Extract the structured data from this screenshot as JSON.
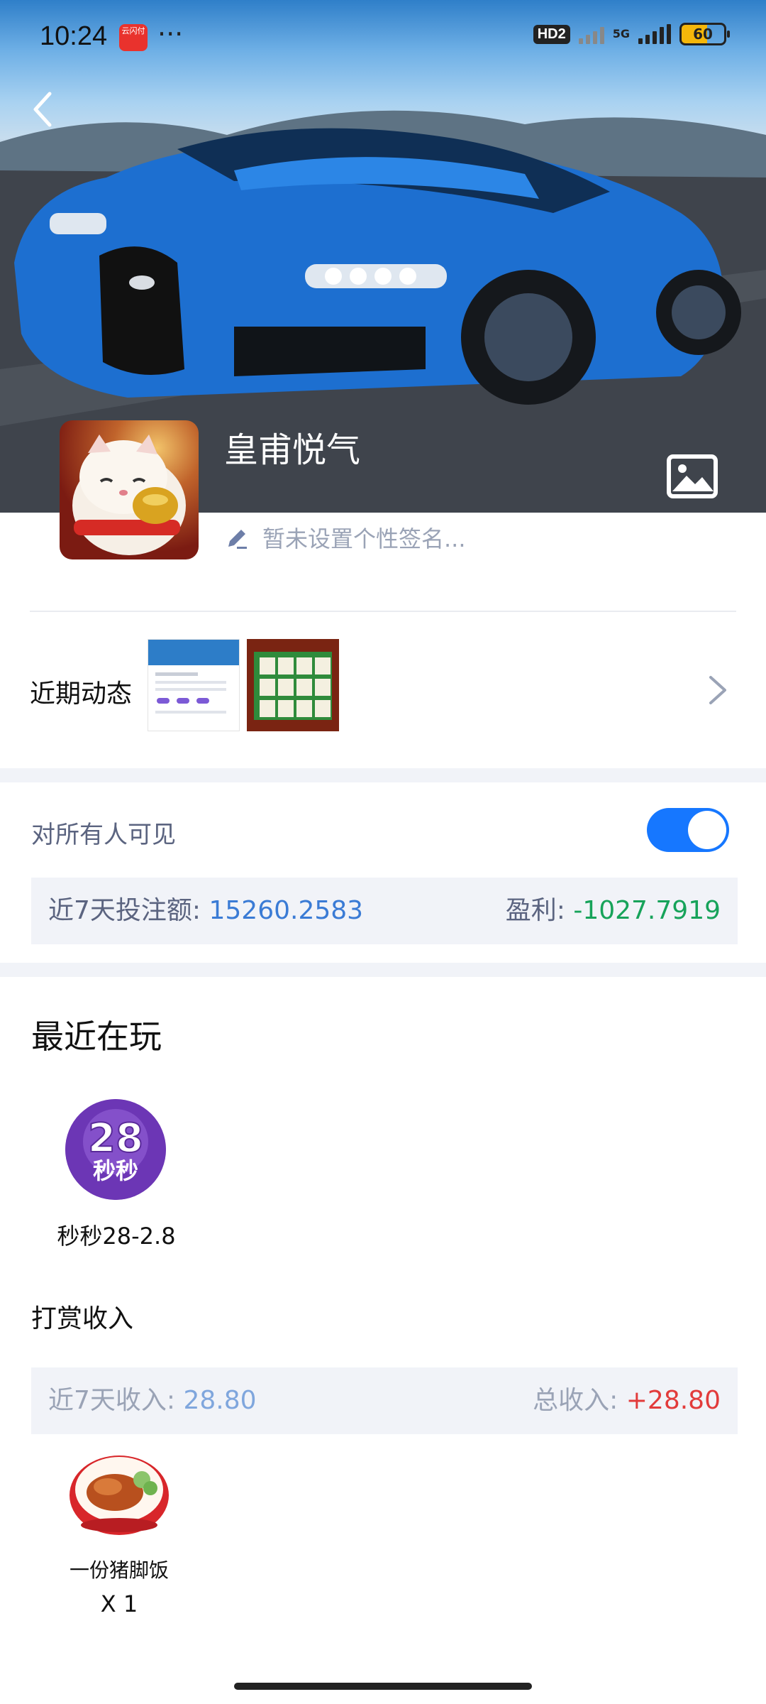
{
  "status_bar": {
    "time": "10:24",
    "app_badge_text": "云闪付",
    "more": "···",
    "hd_label": "HD2",
    "network_label": "5G",
    "battery_level": "60"
  },
  "profile": {
    "nickname": "皇甫悦气",
    "signature_placeholder": "暂未设置个性签名..."
  },
  "recent_activity": {
    "label": "近期动态"
  },
  "visibility": {
    "label": "对所有人可见",
    "enabled": true
  },
  "bet_stats": {
    "label": "近7天投注额:",
    "value": "15260.2583",
    "profit_label": "盈利:",
    "profit_value": "-1027.7919"
  },
  "recent_playing": {
    "title": "最近在玩",
    "games": [
      {
        "icon_text": "28",
        "icon_subtext": "秒秒",
        "name": "秒秒28-2.8"
      }
    ]
  },
  "tip_income": {
    "title": "打赏收入",
    "week_label": "近7天收入:",
    "week_value": "28.80",
    "total_label": "总收入:",
    "total_value": "+28.80",
    "gifts": [
      {
        "name": "一份猪脚饭",
        "count": "X 1"
      }
    ]
  },
  "colors": {
    "accent": "#1677ff",
    "positive": "#17a35a",
    "negative": "#e23b3b",
    "muted": "#9aa3b6"
  },
  "icons": [
    "back-arrow-icon",
    "gallery-icon",
    "edit-pencil-icon",
    "chevron-right-icon"
  ]
}
